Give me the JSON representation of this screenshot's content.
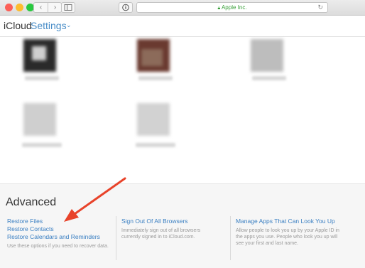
{
  "browser": {
    "address": "Apple Inc."
  },
  "header": {
    "brand": "iCloud",
    "section": "Settings"
  },
  "advanced": {
    "title": "Advanced",
    "restore": {
      "links": [
        "Restore Files",
        "Restore Contacts",
        "Restore Calendars and Reminders"
      ],
      "description": "Use these options if you need to recover data."
    },
    "signout": {
      "link": "Sign Out Of All Browsers",
      "description": "Immediately sign out of all browsers currently signed in to iCloud.com."
    },
    "manage": {
      "link": "Manage Apps That Can Look You Up",
      "description": "Allow people to look you up by your Apple ID in the apps you use. People who look you up will see your first and last name."
    }
  },
  "colors": {
    "accent": "#3a7fc2",
    "arrow": "#e8432a",
    "secure": "#3aa03a"
  },
  "icons": [
    "chevron-left-icon",
    "chevron-right-icon",
    "sidebar-icon",
    "info-icon",
    "lock-icon",
    "refresh-icon",
    "chevron-down-icon"
  ]
}
